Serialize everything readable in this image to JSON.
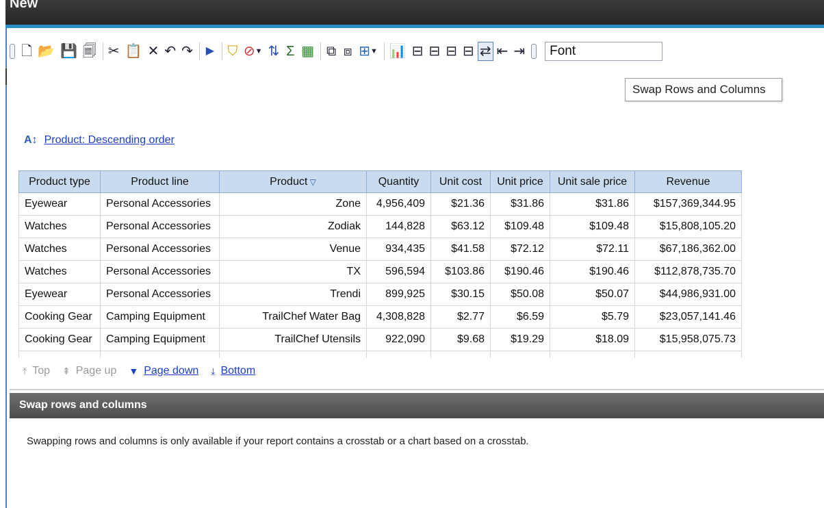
{
  "window": {
    "title": "New"
  },
  "toolbar": {
    "buttons": [
      {
        "name": "new-icon",
        "glyph": "🗋"
      },
      {
        "name": "open-icon",
        "glyph": "📂"
      },
      {
        "name": "save-icon",
        "glyph": "💾"
      },
      {
        "name": "save-as-icon",
        "glyph": "🗐"
      },
      {
        "name": "cut-icon",
        "glyph": "✂"
      },
      {
        "name": "paste-icon",
        "glyph": "📋"
      },
      {
        "name": "delete-icon",
        "glyph": "✕"
      },
      {
        "name": "undo-icon",
        "glyph": "↶"
      },
      {
        "name": "redo-icon",
        "glyph": "↷"
      },
      {
        "name": "run-icon",
        "glyph": "▶"
      },
      {
        "name": "filter-icon",
        "glyph": "⛉"
      },
      {
        "name": "suppress-icon",
        "glyph": "⊘"
      },
      {
        "name": "sort-icon",
        "glyph": "⇅"
      },
      {
        "name": "summarize-icon",
        "glyph": "Σ"
      },
      {
        "name": "calculate-icon",
        "glyph": "▦"
      },
      {
        "name": "group-icon",
        "glyph": "⧉"
      },
      {
        "name": "ungroup-icon",
        "glyph": "⧈"
      },
      {
        "name": "pivot-icon",
        "glyph": "⊞"
      },
      {
        "name": "chart-icon",
        "glyph": "📊"
      },
      {
        "name": "insert-row-icon",
        "glyph": "⊟"
      },
      {
        "name": "insert-row-after-icon",
        "glyph": "⊟"
      },
      {
        "name": "insert-column-icon",
        "glyph": "⊟"
      },
      {
        "name": "insert-column-after-icon",
        "glyph": "⊟"
      },
      {
        "name": "swap-rows-columns-icon",
        "glyph": "⇄"
      },
      {
        "name": "move-left-icon",
        "glyph": "⇤"
      },
      {
        "name": "move-right-icon",
        "glyph": "⇥"
      }
    ],
    "font_value": "Font"
  },
  "tooltip": {
    "text": "Swap Rows and Columns"
  },
  "sort": {
    "icon": "az-sort-icon",
    "label": "Product: Descending order"
  },
  "table": {
    "headers": [
      "Product type",
      "Product line",
      "Product",
      "Quantity",
      "Unit cost",
      "Unit price",
      "Unit sale price",
      "Revenue"
    ],
    "rows": [
      [
        "Eyewear",
        "Personal Accessories",
        "Zone",
        "4,956,409",
        "$21.36",
        "$31.86",
        "$31.86",
        "$157,369,344.95"
      ],
      [
        "Watches",
        "Personal Accessories",
        "Zodiak",
        "144,828",
        "$63.12",
        "$109.48",
        "$109.48",
        "$15,808,105.20"
      ],
      [
        "Watches",
        "Personal Accessories",
        "Venue",
        "934,435",
        "$41.58",
        "$72.12",
        "$72.11",
        "$67,186,362.00"
      ],
      [
        "Watches",
        "Personal Accessories",
        "TX",
        "596,594",
        "$103.86",
        "$190.46",
        "$190.46",
        "$112,878,735.70"
      ],
      [
        "Eyewear",
        "Personal Accessories",
        "Trendi",
        "899,925",
        "$30.15",
        "$50.08",
        "$50.07",
        "$44,986,931.00"
      ],
      [
        "Cooking Gear",
        "Camping Equipment",
        "TrailChef Water Bag",
        "4,308,828",
        "$2.77",
        "$6.59",
        "$5.79",
        "$23,057,141.46"
      ],
      [
        "Cooking Gear",
        "Camping Equipment",
        "TrailChef Utensils",
        "922,090",
        "$9.68",
        "$19.29",
        "$18.09",
        "$15,958,075.73"
      ]
    ]
  },
  "pager": {
    "top": "Top",
    "page_up": "Page up",
    "page_down": "Page down",
    "bottom": "Bottom"
  },
  "panel": {
    "title": "Swap rows and columns",
    "message": "Swapping rows and columns is only available if your report contains a crosstab or a chart based on a crosstab."
  }
}
